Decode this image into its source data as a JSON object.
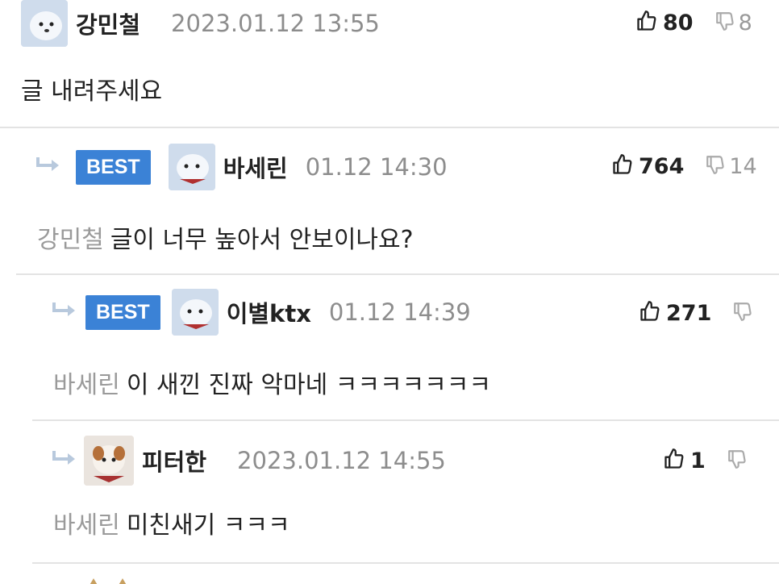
{
  "comments": [
    {
      "author": "강민철",
      "time": "2023.01.12 13:55",
      "up": "80",
      "down": "8",
      "text": "글 내려주세요"
    },
    {
      "badge": "BEST",
      "author": "바세린",
      "time": "01.12 14:30",
      "up": "764",
      "down": "14",
      "mention": "강민철",
      "text": "글이 너무 높아서 안보이나요?"
    },
    {
      "badge": "BEST",
      "author": "이별ktx",
      "time": "01.12 14:39",
      "up": "271",
      "mention": "바세린",
      "text": "이 새낀 진짜 악마네 ㅋㅋㅋㅋㅋㅋㅋ"
    },
    {
      "author": "피터한",
      "time": "2023.01.12 14:55",
      "up": "1",
      "mention": "바세린",
      "text": "미친새기 ㅋㅋㅋ"
    }
  ],
  "colors": {
    "best_badge": "#3b82d6",
    "muted": "#9a9a9a",
    "divider": "#e3e3e3"
  },
  "icons": {
    "upvote": "thumbs-up-icon",
    "downvote": "thumbs-down-icon",
    "reply": "reply-arrow-icon"
  }
}
